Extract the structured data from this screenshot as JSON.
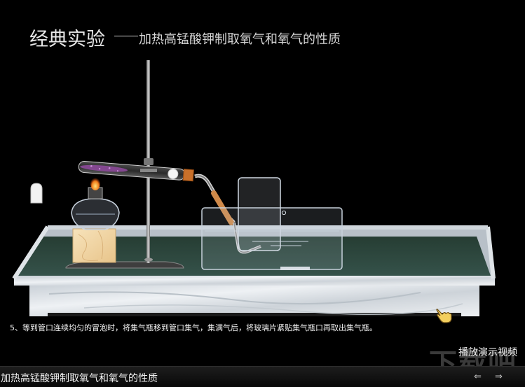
{
  "header": {
    "title_main": "经典实验",
    "title_sub": "加热高锰酸钾制取氧气和氧气的性质"
  },
  "step": {
    "caption": "5、等到管口连续均匀的冒泡时，将集气瓶移到管口集气，集满气后，将玻璃片紧贴集气瓶口再取出集气瓶。"
  },
  "controls": {
    "play_demo": "播放演示视频",
    "prev": "⇐",
    "next": "⇒"
  },
  "footer": {
    "experiment_title": "加热高锰酸钾制取氧气和氧气的性质"
  },
  "icons": {
    "pointer": "hand-pointer-icon"
  },
  "colors": {
    "background": "#000000",
    "bench_top": "#2f4a3e",
    "marble": "#d8dde2",
    "wood_block": "#f3d9a8",
    "flame": "#f06a1a",
    "potassium_permanganate": "#8d4a9a"
  }
}
